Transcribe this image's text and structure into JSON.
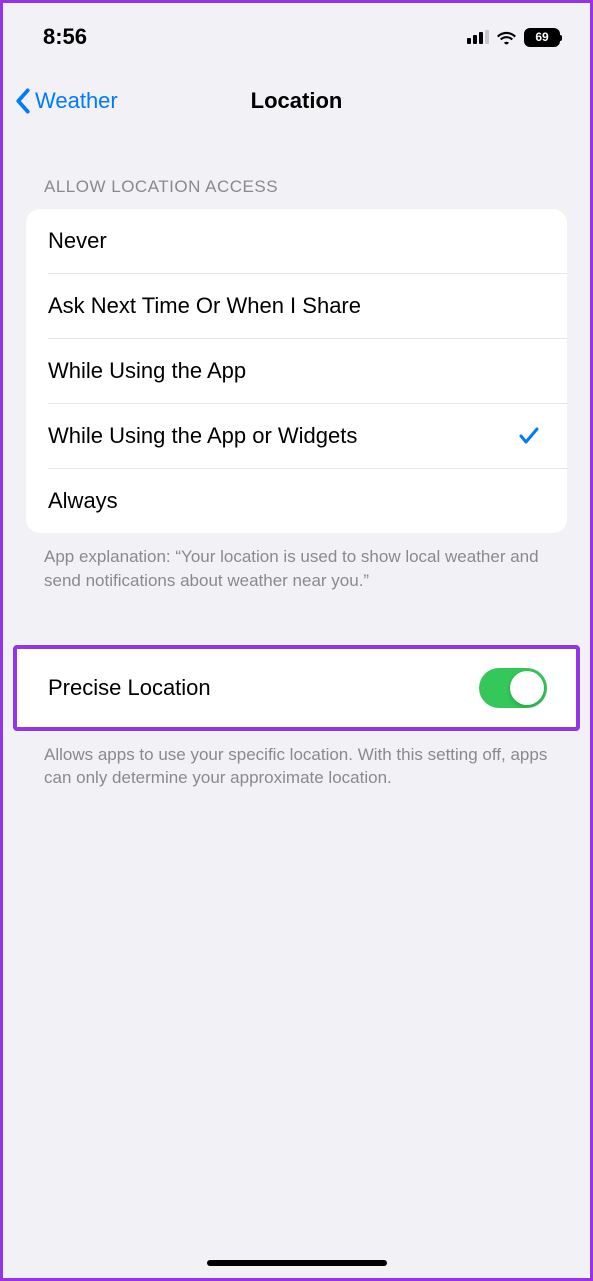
{
  "status": {
    "time": "8:56",
    "battery": "69"
  },
  "nav": {
    "back_label": "Weather",
    "title": "Location"
  },
  "sections": {
    "access_header": "ALLOW LOCATION ACCESS",
    "options": [
      "Never",
      "Ask Next Time Or When I Share",
      "While Using the App",
      "While Using the App or Widgets",
      "Always"
    ],
    "selected_index": 3,
    "access_footer": "App explanation: “Your location is used to show local weather and send notifications about weather near you.”"
  },
  "precise": {
    "label": "Precise Location",
    "enabled": true,
    "footer": "Allows apps to use your specific location. With this setting off, apps can only determine your approximate location."
  }
}
